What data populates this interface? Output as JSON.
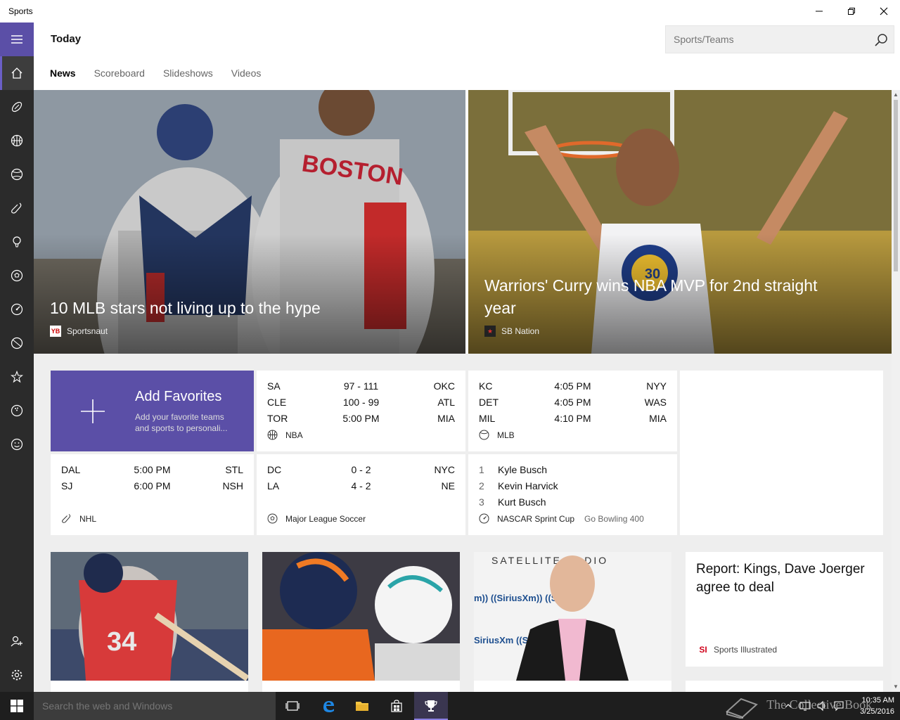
{
  "window": {
    "title": "Sports"
  },
  "header": {
    "title": "Today"
  },
  "search": {
    "placeholder": "Sports/Teams"
  },
  "tabs": [
    {
      "label": "News"
    },
    {
      "label": "Scoreboard"
    },
    {
      "label": "Slideshows"
    },
    {
      "label": "Videos"
    }
  ],
  "rail": {
    "items": [
      "hamburger-icon",
      "home-icon",
      "football-icon",
      "basketball-icon",
      "baseball-icon",
      "hockey-icon",
      "golf-icon",
      "soccer-icon",
      "nascar-icon",
      "tennis-icon",
      "star-icon",
      "bowling-icon",
      "smiley-icon",
      "add-person-icon",
      "settings-icon"
    ]
  },
  "hero": [
    {
      "title": "10 MLB stars not living up to the hype",
      "source": "Sportsnaut",
      "logo": "YB"
    },
    {
      "title": "Warriors' Curry wins NBA MVP for 2nd straight year",
      "source": "SB Nation",
      "logo": "★"
    }
  ],
  "favorites": {
    "title": "Add Favorites",
    "description": "Add your favorite teams and sports to personali..."
  },
  "nba": {
    "league": "NBA",
    "rows": [
      {
        "t1": "SA",
        "mid": "97  -  111",
        "t2": "OKC"
      },
      {
        "t1": "CLE",
        "mid": "100  -  99",
        "t2": "ATL"
      },
      {
        "t1": "TOR",
        "mid": "5:00 PM",
        "t2": "MIA"
      }
    ]
  },
  "mlb": {
    "league": "MLB",
    "rows": [
      {
        "t1": "KC",
        "mid": "4:05 PM",
        "t2": "NYY"
      },
      {
        "t1": "DET",
        "mid": "4:05 PM",
        "t2": "WAS"
      },
      {
        "t1": "MIL",
        "mid": "4:10 PM",
        "t2": "MIA"
      }
    ]
  },
  "nhl": {
    "league": "NHL",
    "rows": [
      {
        "t1": "DAL",
        "mid": "5:00 PM",
        "t2": "STL"
      },
      {
        "t1": "SJ",
        "mid": "6:00 PM",
        "t2": "NSH"
      }
    ]
  },
  "mls": {
    "league": "Major League Soccer",
    "rows": [
      {
        "t1": "DC",
        "mid": "0  -  2",
        "t2": "NYC"
      },
      {
        "t1": "LA",
        "mid": "4  -  2",
        "t2": "NE"
      }
    ]
  },
  "nascar": {
    "league": "NASCAR Sprint Cup",
    "event": "Go Bowling 400",
    "rows": [
      {
        "pos": "1",
        "name": "Kyle Busch"
      },
      {
        "pos": "2",
        "name": "Kevin Harvick"
      },
      {
        "pos": "3",
        "name": "Kurt Busch"
      }
    ]
  },
  "story": {
    "title": "Report: Kings, Dave Joerger agree to deal",
    "source": "Sports Illustrated",
    "logo": "SI"
  },
  "image_cards": {
    "satellite_text": "SATELLITE RADIO"
  },
  "taskbar": {
    "search_placeholder": "Search the web and Windows",
    "time": "10:35 AM",
    "date": "3/25/2016"
  },
  "watermark": "The Collective Book",
  "colors": {
    "accent": "#5b4fa7",
    "rail": "#2b2b2b",
    "taskbar": "#1e1e1e"
  }
}
